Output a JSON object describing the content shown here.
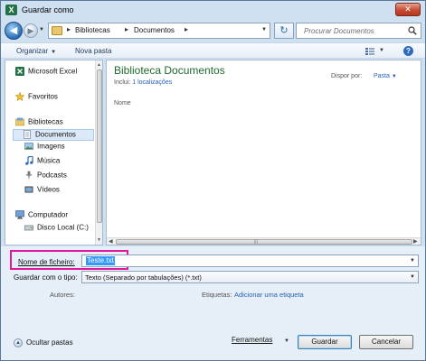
{
  "window": {
    "app_icon_letter": "X",
    "title": "Guardar como",
    "close_label": "✕"
  },
  "navigation": {
    "back_icon": "◀",
    "forward_icon": "▶",
    "breadcrumb": [
      "Bibliotecas",
      "Documentos"
    ],
    "refresh_icon": "↻",
    "search_placeholder": "Procurar Documentos"
  },
  "toolbar": {
    "organize_label": "Organizar",
    "new_folder_label": "Nova pasta",
    "help_label": "?"
  },
  "sidebar": {
    "items": [
      {
        "label": "Microsoft Excel",
        "icon": "excel-icon"
      },
      {
        "label": "Favoritos",
        "icon": "star-icon"
      },
      {
        "label": "Bibliotecas",
        "icon": "libraries-icon"
      },
      {
        "label": "Documentos",
        "icon": "documents-icon",
        "selected": true
      },
      {
        "label": "Imagens",
        "icon": "pictures-icon"
      },
      {
        "label": "Música",
        "icon": "music-icon"
      },
      {
        "label": "Podcasts",
        "icon": "podcast-icon"
      },
      {
        "label": "Vídeos",
        "icon": "videos-icon"
      },
      {
        "label": "Computador",
        "icon": "computer-icon"
      },
      {
        "label": "Disco Local (C:)",
        "icon": "drive-icon"
      }
    ]
  },
  "main": {
    "library_title": "Biblioteca Documentos",
    "includes_label": "Inclui:",
    "includes_link": "1 localizações",
    "sort_label": "Dispor por:",
    "sort_value": "Pasta",
    "column_name": "Nome"
  },
  "form": {
    "filename_label": "Nome de ficheiro:",
    "filename_value": "Teste.txt",
    "type_label": "Guardar com o tipo:",
    "type_value": "Texto (Separado por tabulações) (*.txt)",
    "authors_label": "Autores:",
    "tags_label": "Etiquetas:",
    "tags_link": "Adicionar uma etiqueta"
  },
  "footer": {
    "hide_folders_label": "Ocultar pastas",
    "tools_label": "Ferramentas",
    "save_label": "Guardar",
    "cancel_label": "Cancelar"
  },
  "colors": {
    "library_title": "#1e6b2f",
    "link": "#2563b8",
    "highlight_box": "#e1179c",
    "selection": "#3399ff"
  }
}
